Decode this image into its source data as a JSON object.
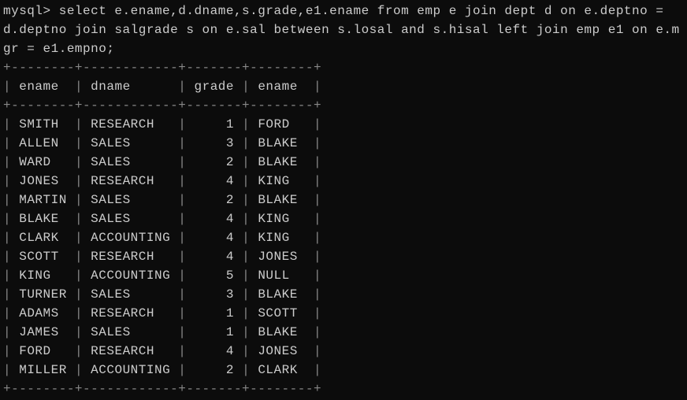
{
  "prompt": {
    "label": "mysql>",
    "query": "select e.ename,d.dname,s.grade,e1.ename from emp e join dept d on e.deptno = d.deptno join salgrade s on e.sal between s.losal and s.hisal left join emp e1 on e.mgr = e1.empno;"
  },
  "table": {
    "headers": [
      "ename",
      "dname",
      "grade",
      "ename"
    ],
    "rows": [
      {
        "ename": "SMITH",
        "dname": "RESEARCH",
        "grade": "1",
        "mgr_ename": "FORD"
      },
      {
        "ename": "ALLEN",
        "dname": "SALES",
        "grade": "3",
        "mgr_ename": "BLAKE"
      },
      {
        "ename": "WARD",
        "dname": "SALES",
        "grade": "2",
        "mgr_ename": "BLAKE"
      },
      {
        "ename": "JONES",
        "dname": "RESEARCH",
        "grade": "4",
        "mgr_ename": "KING"
      },
      {
        "ename": "MARTIN",
        "dname": "SALES",
        "grade": "2",
        "mgr_ename": "BLAKE"
      },
      {
        "ename": "BLAKE",
        "dname": "SALES",
        "grade": "4",
        "mgr_ename": "KING"
      },
      {
        "ename": "CLARK",
        "dname": "ACCOUNTING",
        "grade": "4",
        "mgr_ename": "KING"
      },
      {
        "ename": "SCOTT",
        "dname": "RESEARCH",
        "grade": "4",
        "mgr_ename": "JONES"
      },
      {
        "ename": "KING",
        "dname": "ACCOUNTING",
        "grade": "5",
        "mgr_ename": "NULL"
      },
      {
        "ename": "TURNER",
        "dname": "SALES",
        "grade": "3",
        "mgr_ename": "BLAKE"
      },
      {
        "ename": "ADAMS",
        "dname": "RESEARCH",
        "grade": "1",
        "mgr_ename": "SCOTT"
      },
      {
        "ename": "JAMES",
        "dname": "SALES",
        "grade": "1",
        "mgr_ename": "BLAKE"
      },
      {
        "ename": "FORD",
        "dname": "RESEARCH",
        "grade": "4",
        "mgr_ename": "JONES"
      },
      {
        "ename": "MILLER",
        "dname": "ACCOUNTING",
        "grade": "2",
        "mgr_ename": "CLARK"
      }
    ],
    "col_widths": {
      "ename": 8,
      "dname": 12,
      "grade": 7,
      "mgr_ename": 8
    }
  }
}
